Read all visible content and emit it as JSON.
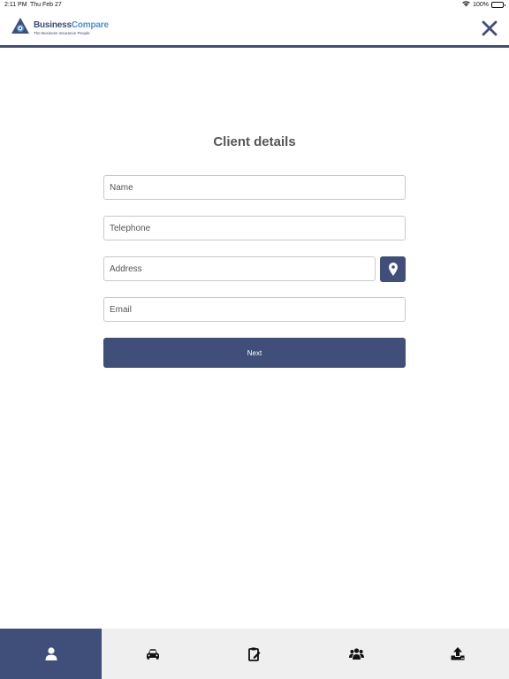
{
  "status_bar": {
    "time": "2:11 PM",
    "date": "Thu Feb 27",
    "battery": "100%"
  },
  "header": {
    "brand_primary": "Business",
    "brand_accent": "Compare",
    "tagline": "The Business Insurance People",
    "close_icon": "close-icon"
  },
  "form": {
    "title": "Client details",
    "name_placeholder": "Name",
    "telephone_placeholder": "Telephone",
    "address_placeholder": "Address",
    "email_placeholder": "Email",
    "location_icon": "map-pin-icon",
    "next_label": "Next"
  },
  "tabs": [
    {
      "icon": "user-icon",
      "active": true
    },
    {
      "icon": "car-icon",
      "active": false
    },
    {
      "icon": "clipboard-edit-icon",
      "active": false
    },
    {
      "icon": "group-icon",
      "active": false
    },
    {
      "icon": "upload-icon",
      "active": false
    }
  ],
  "colors": {
    "primary": "#3f4f79",
    "accent": "#4a90d6",
    "tab_bar_bg": "#efefef",
    "title_text": "#555555"
  }
}
